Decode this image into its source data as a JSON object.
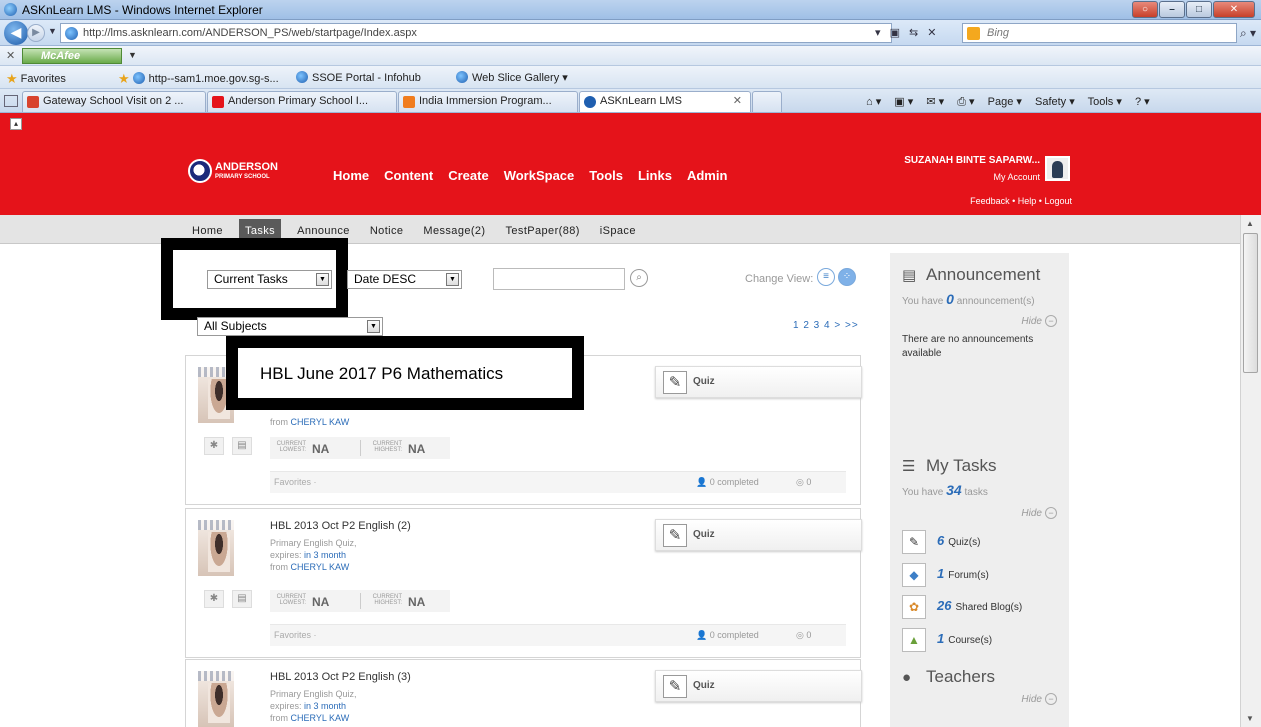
{
  "window": {
    "title": "ASKnLearn LMS - Windows Internet Explorer",
    "url": "http://lms.asknlearn.com/ANDERSON_PS/web/startpage/Index.aspx",
    "search_placeholder": "Bing"
  },
  "toolbar": {
    "mcafee_label": "McAfee"
  },
  "favorites": {
    "label": "Favorites",
    "items": [
      "http--sam1.moe.gov.sg-s...",
      "SSOE Portal - Infohub",
      "Web Slice Gallery ▾"
    ]
  },
  "tabs": [
    {
      "label": "Gateway School Visit on 2 ...",
      "color": "#d8432d"
    },
    {
      "label": "Anderson Primary School I...",
      "color": "#e5131a"
    },
    {
      "label": "India Immersion Program...",
      "color": "#f07c1e"
    },
    {
      "label": "ASKnLearn LMS",
      "color": "#1f5fb0",
      "active": true
    }
  ],
  "commands": [
    "Page ▾",
    "Safety ▾",
    "Tools ▾"
  ],
  "site": {
    "logo_main": "ANDERSON",
    "logo_sub": "PRIMARY SCHOOL",
    "nav": [
      "Home",
      "Content",
      "Create",
      "WorkSpace",
      "Tools",
      "Links",
      "Admin"
    ],
    "user_name": "SUZANAH BINTE SAPARW...",
    "my_account": "My Account",
    "header_links": "Feedback • Help • Logout",
    "subnav": [
      "Home",
      "Tasks",
      "Announce",
      "Notice",
      "Message(2)",
      "TestPaper(88)",
      "iSpace"
    ],
    "subnav_active": "Tasks"
  },
  "filters": {
    "task_filter": "Current Tasks",
    "sort": "Date DESC",
    "subject": "All Subjects",
    "change_view": "Change View:",
    "pager": "1 2 3 4 > >>"
  },
  "tasks": [
    {
      "title": "HBL June 2017 P6 Mathematics",
      "from_label": "from",
      "from": "CHERYL KAW",
      "lowest": "NA",
      "highest": "NA",
      "favorites": "Favorites ·",
      "completed": "0 completed",
      "comments": "0",
      "type": "Quiz"
    },
    {
      "title": "HBL 2013 Oct P2 English (2)",
      "subtitle": "Primary English Quiz,",
      "expires_label": "expires:",
      "expires": "in 3 month",
      "from_label": "from",
      "from": "CHERYL KAW",
      "lowest": "NA",
      "highest": "NA",
      "favorites": "Favorites ·",
      "completed": "0 completed",
      "comments": "0",
      "type": "Quiz"
    },
    {
      "title": "HBL 2013 Oct P2 English (3)",
      "subtitle": "Primary English Quiz,",
      "expires_label": "expires:",
      "expires": "in 3 month",
      "from_label": "from",
      "from": "CHERYL KAW",
      "type": "Quiz"
    }
  ],
  "score_labels": {
    "lowest_1": "CURRENT",
    "lowest_2": "LOWEST:",
    "highest_1": "CURRENT",
    "highest_2": "HIGHEST:"
  },
  "sidebar": {
    "announcement": {
      "title": "Announcement",
      "summary_pre": "You have",
      "count": "0",
      "summary_post": "announcement(s)",
      "hide": "Hide",
      "empty": "There are no announcements available"
    },
    "my_tasks": {
      "title": "My Tasks",
      "summary_pre": "You have",
      "count": "34",
      "summary_post": "tasks",
      "hide": "Hide",
      "items": [
        {
          "count": "6",
          "label": "Quiz(s)"
        },
        {
          "count": "1",
          "label": "Forum(s)"
        },
        {
          "count": "26",
          "label": "Shared Blog(s)"
        },
        {
          "count": "1",
          "label": "Course(s)"
        }
      ]
    },
    "teachers": {
      "title": "Teachers",
      "hide": "Hide"
    }
  }
}
